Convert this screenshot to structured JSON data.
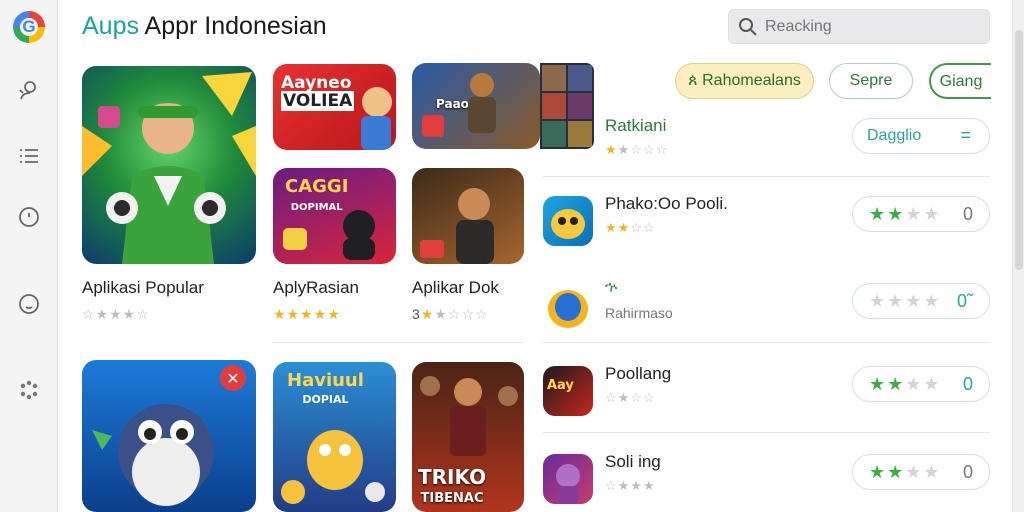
{
  "brand": {
    "prefix": "Aups",
    "rest": " Appr Indonesian"
  },
  "search": {
    "placeholder": "Reacking"
  },
  "chips": [
    "ጰ Rahomealans",
    "Sepre",
    "Giang"
  ],
  "colors": {
    "accent": "#1aa39a",
    "green": "#3cae48",
    "chip_yellow": "#fbeec0",
    "star": "#f2b520"
  },
  "rail": {
    "icons": [
      "user-search-icon",
      "list-icon",
      "clock-icon",
      "smiley-icon",
      "apps-grid-icon"
    ]
  },
  "featured": {
    "name": "Aplikasi Popular",
    "stars": 3
  },
  "tiles": [
    {
      "name": "AplyRasian",
      "art_title": "Aayneo\nVOLIEA",
      "stars": 5
    },
    {
      "name": "Aplikar Dok",
      "prefix": "3",
      "art_title": "Paaooali",
      "stars": 2
    },
    {
      "art_title": "CAGGI\nDOPIMAL"
    },
    {
      "art_title": ""
    }
  ],
  "bottom_tiles": [
    {
      "art_title": ""
    },
    {
      "art_title": "Haviuul\nDOPIAL"
    },
    {
      "art_title": "TRIKO\nTIBENAC"
    }
  ],
  "list": [
    {
      "title": "Ratkiani",
      "sub": "",
      "stars": 2,
      "pill_text": "Dagglio",
      "pill_menu": "="
    },
    {
      "title": "Phako:Oo Pooli.",
      "sub": "",
      "stars": 2,
      "pill_stars": 2,
      "pill_val": "0"
    },
    {
      "title": "ኍ",
      "sub": "Rahirmaso",
      "pill_stars": 0,
      "pill_val": "0˜"
    },
    {
      "title": "Poollang",
      "sub": "",
      "stars": 0,
      "pill_stars": 2,
      "pill_val": "0"
    },
    {
      "title": "Soli ing",
      "sub": "",
      "stars": 0,
      "pill_stars": 2,
      "pill_val": "0"
    }
  ]
}
